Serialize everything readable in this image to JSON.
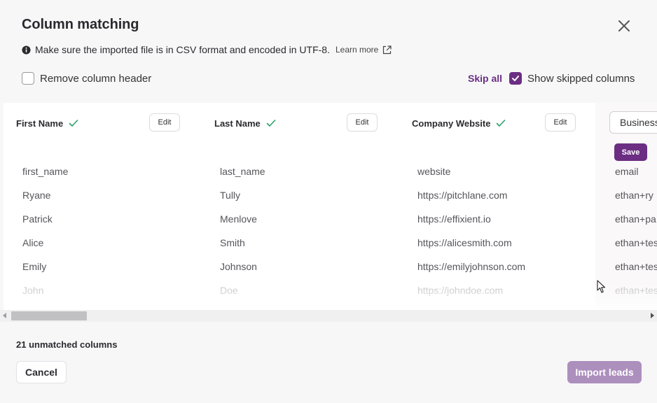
{
  "dialog": {
    "title": "Column matching",
    "info_text": "Make sure the imported file is in CSV format and encoded in UTF-8.",
    "learn_more": "Learn more"
  },
  "options": {
    "remove_header_label": "Remove column header",
    "remove_header_checked": false,
    "skip_all_label": "Skip all",
    "show_skipped_label": "Show skipped columns",
    "show_skipped_checked": true
  },
  "columns": [
    {
      "header": "First Name",
      "edit_label": "Edit",
      "rows": [
        "first_name",
        "Ryane",
        "Patrick",
        "Alice",
        "Emily",
        "John"
      ]
    },
    {
      "header": "Last Name",
      "edit_label": "Edit",
      "rows": [
        "last_name",
        "Tully",
        "Menlove",
        "Smith",
        "Johnson",
        "Doe"
      ]
    },
    {
      "header": "Company Website",
      "edit_label": "Edit",
      "rows": [
        "website",
        "https://pitchlane.com",
        "https://effixient.io",
        "https://alicesmith.com",
        "https://emilyjohnson.com",
        "https://johndoe.com"
      ]
    },
    {
      "header_select_value": "Business",
      "save_label": "Save",
      "rows": [
        "email",
        "ethan+ry",
        "ethan+pa",
        "ethan+tes",
        "ethan+tes",
        "ethan+tes"
      ]
    }
  ],
  "footer": {
    "unmatched_text": "21 unmatched columns",
    "cancel_label": "Cancel",
    "import_label": "Import leads"
  },
  "colors": {
    "accent": "#6b2e83",
    "accent_disabled": "#ad8fbe",
    "match_check": "#2e9e6a"
  },
  "icons": {
    "close": "close-icon",
    "info": "info-icon",
    "external_link": "external-link-icon",
    "matched": "check-icon"
  }
}
